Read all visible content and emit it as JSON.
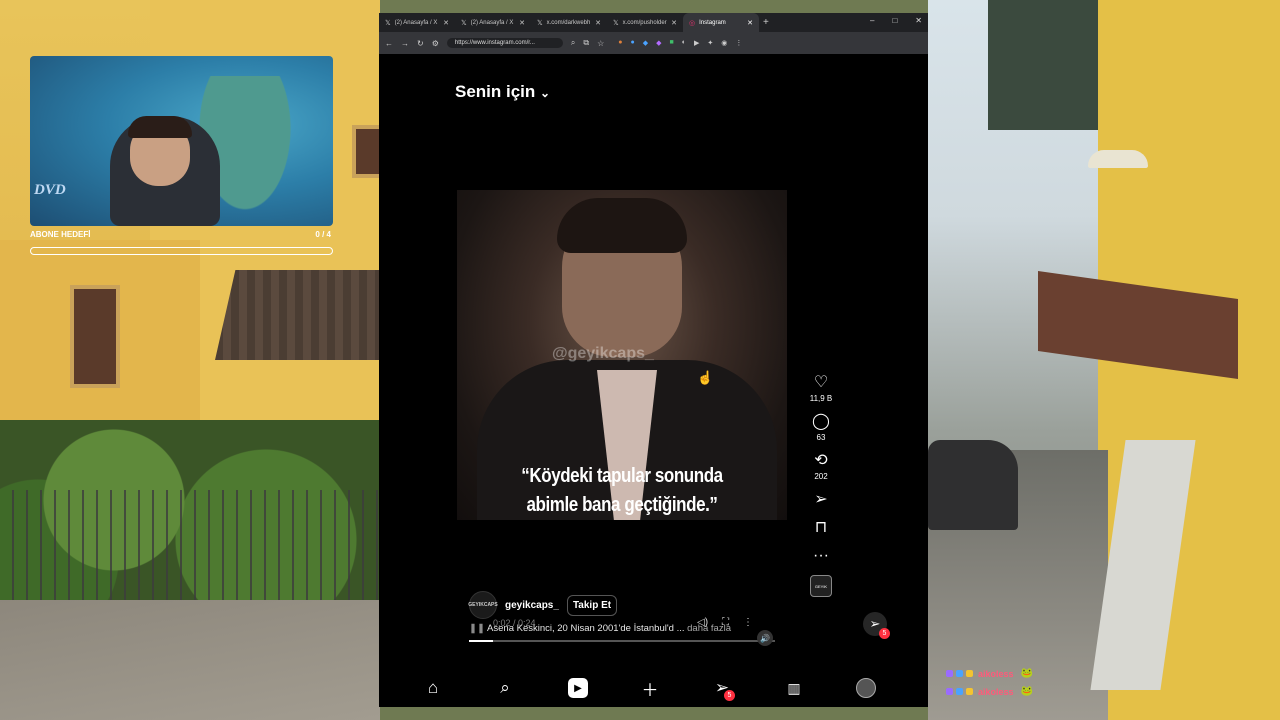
{
  "stream_overlay": {
    "webcam_logo": "DVD",
    "sub_goal_label": "ABONE HEDEFİ",
    "sub_goal_count": "0 / 4",
    "sub_goal_progress": 0
  },
  "browser": {
    "tabs": [
      {
        "label": "(2) Anasayfa / X",
        "icon": "x-logo-icon",
        "active": false
      },
      {
        "label": "(2) Anasayfa / X",
        "icon": "x-logo-icon",
        "active": false
      },
      {
        "label": "x.com/darkwebh",
        "icon": "x-logo-icon",
        "active": false
      },
      {
        "label": "x.com/pusholder",
        "icon": "x-logo-icon",
        "active": false
      },
      {
        "label": "Instagram",
        "icon": "instagram-icon",
        "active": true
      }
    ],
    "new_tab": "+",
    "window_controls": {
      "minimize": "–",
      "maximize": "□",
      "close": "✕"
    },
    "address": "https://www.instagram.com/r...",
    "nav": {
      "back": "←",
      "forward": "→",
      "reload": "↻"
    }
  },
  "instagram": {
    "feed_title": "Senin için",
    "feed_chevron": "⌄",
    "video": {
      "watermark": "@geyikcaps_",
      "caption_line1": "“Köydeki tapular sonunda",
      "caption_line2": "abimle bana geçtiğinde.”",
      "time": "0:02 / 0:24",
      "progress": 0.08
    },
    "author": {
      "avatar_text": "GEYIKCAPS",
      "username": "geyikcaps_",
      "follow_label": "Takip Et"
    },
    "description": "Asena Keskinci, 20 Nisan 2001'de İstanbul'd ...",
    "description_more": "daha fazla",
    "actions": {
      "likes": "11,9 B",
      "comments": "63",
      "reposts": "202",
      "more": "···"
    },
    "dm_badge": "5",
    "nav_dm_badge": "5"
  },
  "chat": [
    {
      "user": "aikoless",
      "emote": "🐸"
    },
    {
      "user": "aikoless",
      "emote": "🐸"
    }
  ],
  "colors": {
    "accent_badge": "#ff3040",
    "bg": "#000000"
  }
}
